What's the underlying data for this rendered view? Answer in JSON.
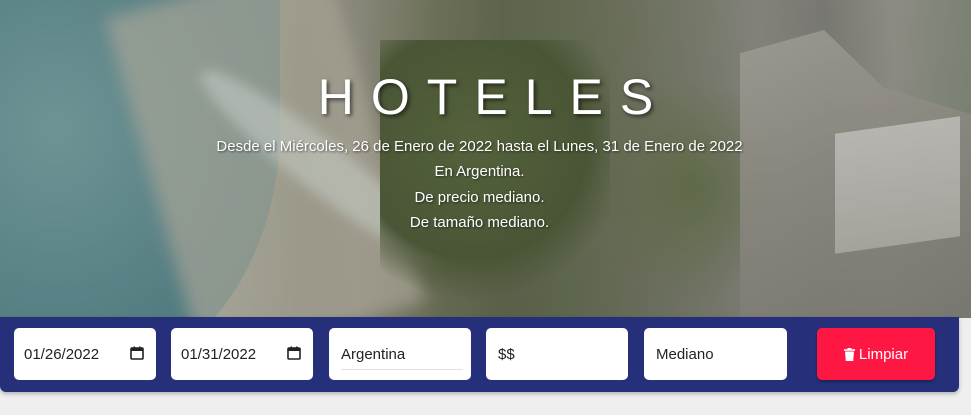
{
  "hero": {
    "title": "HOTELES",
    "lines": [
      "Desde el Miércoles, 26 de Enero de 2022 hasta el Lunes, 31 de Enero de 2022",
      "En Argentina.",
      "De precio mediano.",
      "De tamaño mediano."
    ]
  },
  "filters": {
    "date_from": "01/26/2022",
    "date_to": "01/31/2022",
    "country": "Argentina",
    "price": "$$",
    "size": "Mediano",
    "clear_label": "Limpiar",
    "clear_color": "#ff1744",
    "bar_color": "#26307a"
  },
  "icons": {
    "date_from": "calendar-icon",
    "date_to": "calendar-icon",
    "clear": "trash-icon"
  }
}
